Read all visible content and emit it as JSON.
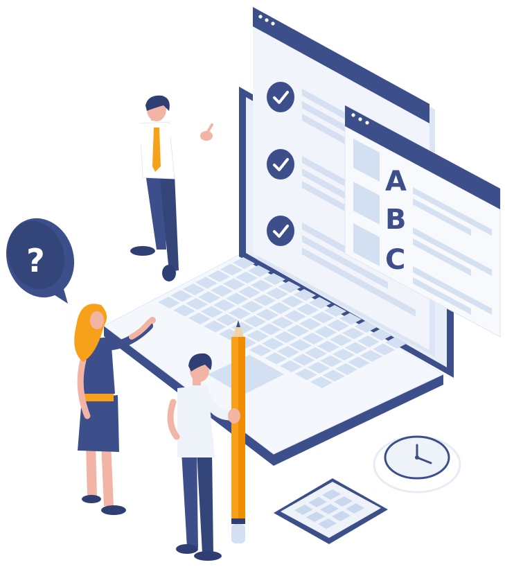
{
  "illustration": {
    "answer_options": [
      "A",
      "B",
      "C"
    ],
    "question_mark": "?",
    "icons": [
      "check-icon",
      "question-bubble-icon",
      "clock-icon",
      "calendar-icon",
      "pencil-icon"
    ],
    "colors": {
      "navy": "#3d4f8a",
      "dark_navy": "#34457a",
      "screen_bg": "#f1f5fb",
      "line_blue": "#d5e1f1",
      "key_blue": "#d3e0f2",
      "orange": "#f7a11a",
      "skin": "#f2b4a5",
      "hair": "#2f3f73",
      "white": "#ffffff"
    }
  }
}
